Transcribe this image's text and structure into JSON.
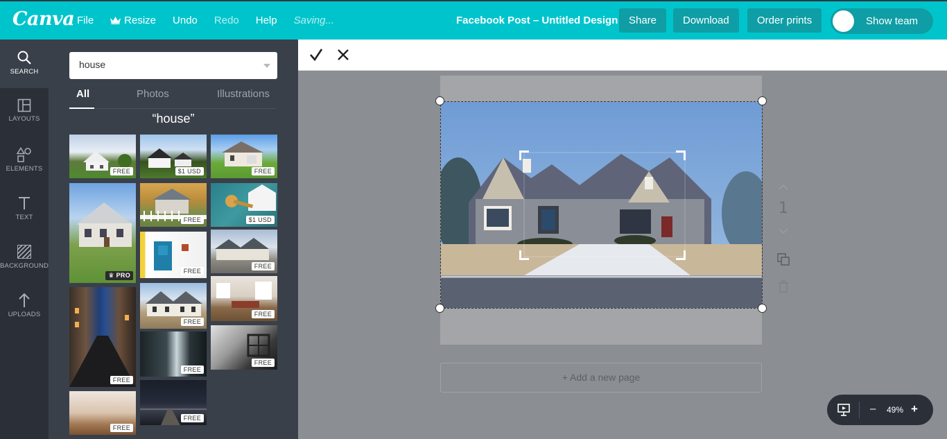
{
  "app": {
    "logo": "Canva",
    "menu": {
      "file": "File",
      "resize": "Resize",
      "undo": "Undo",
      "redo": "Redo",
      "help": "Help",
      "status": "Saving..."
    },
    "document_title": "Facebook Post – Untitled Design",
    "buttons": {
      "share": "Share",
      "download": "Download",
      "order_prints": "Order prints",
      "show_team": "Show team"
    },
    "accent_color": "#00c4cc"
  },
  "rail": {
    "items": [
      {
        "label": "SEARCH",
        "icon": "search-icon"
      },
      {
        "label": "LAYOUTS",
        "icon": "layouts-icon"
      },
      {
        "label": "ELEMENTS",
        "icon": "elements-icon"
      },
      {
        "label": "TEXT",
        "icon": "text-icon"
      },
      {
        "label": "BACKGROUND",
        "icon": "background-icon"
      },
      {
        "label": "UPLOADS",
        "icon": "uploads-icon"
      }
    ]
  },
  "search": {
    "value": "house",
    "tabs": [
      "All",
      "Photos",
      "Illustrations"
    ],
    "active_tab": "All",
    "query_title": "“house”",
    "results": [
      {
        "badge": "FREE"
      },
      {
        "badge": "$1 USD"
      },
      {
        "badge": "FREE"
      },
      {
        "badge": "PRO"
      },
      {
        "badge": "FREE"
      },
      {
        "badge": "$1 USD"
      },
      {
        "badge": "FREE"
      },
      {
        "badge": "FREE"
      },
      {
        "badge": "FREE"
      },
      {
        "badge": "FREE"
      },
      {
        "badge": "FREE"
      },
      {
        "badge": "FREE"
      },
      {
        "badge": "FREE"
      },
      {
        "badge": "FREE"
      },
      {
        "badge": "FREE"
      }
    ]
  },
  "canvas": {
    "page_number": "1",
    "add_page": "+ Add a new page",
    "zoom": "49%"
  }
}
